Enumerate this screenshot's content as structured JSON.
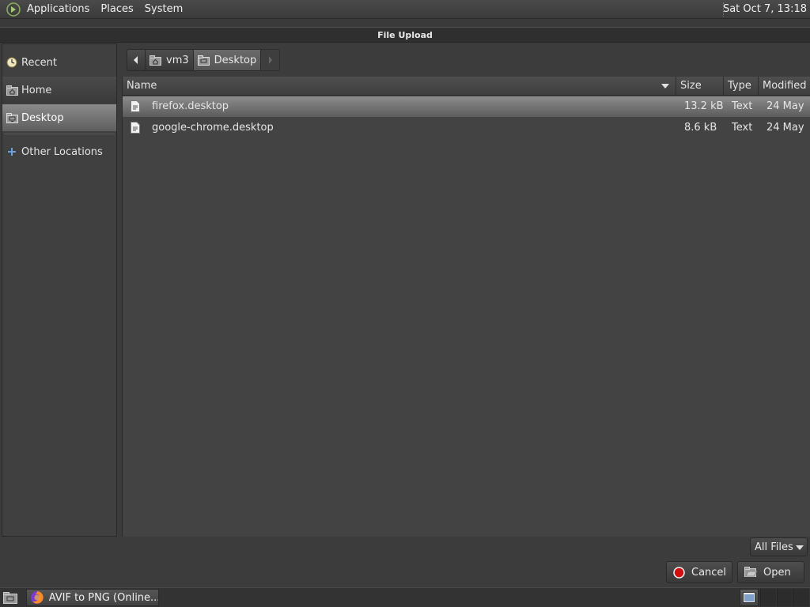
{
  "top_panel": {
    "menus": [
      "Applications",
      "Places",
      "System"
    ],
    "clock": "Sat Oct  7, 13:18"
  },
  "dialog": {
    "title": "File Upload"
  },
  "sidebar": {
    "items": [
      {
        "label": "Recent",
        "icon": "clock-icon"
      },
      {
        "label": "Home",
        "icon": "home-folder-icon"
      },
      {
        "label": "Desktop",
        "icon": "desktop-folder-icon",
        "selected": true
      },
      {
        "label": "Other Locations",
        "icon": "plus-icon"
      }
    ]
  },
  "pathbar": {
    "crumbs": [
      {
        "label": "vm3",
        "icon": "home-folder-icon"
      },
      {
        "label": "Desktop",
        "icon": "desktop-folder-icon",
        "active": true
      }
    ]
  },
  "filelist": {
    "columns": [
      "Name",
      "Size",
      "Type",
      "Modified"
    ],
    "rows": [
      {
        "name": "firefox.desktop",
        "size": "13.2 kB",
        "type": "Text",
        "modified": "24 May",
        "selected": true
      },
      {
        "name": "google-chrome.desktop",
        "size": "8.6 kB",
        "type": "Text",
        "modified": "24 May",
        "selected": false
      }
    ]
  },
  "controls": {
    "filter_label": "All Files",
    "cancel_label": "Cancel",
    "open_label": "Open"
  },
  "taskbar": {
    "window_label": "AVIF to PNG (Online..."
  },
  "colors": {
    "accent_selected": "#8c8c8c",
    "cancel_red": "#d01010"
  }
}
